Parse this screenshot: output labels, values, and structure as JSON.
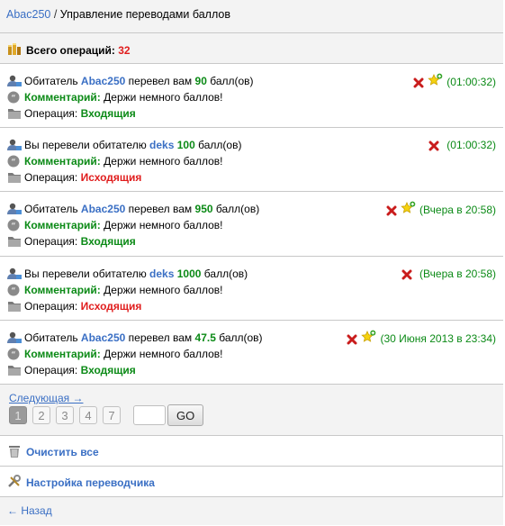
{
  "header": {
    "user_link": "Abac250",
    "separator": " / ",
    "title": "Управление переводами баллов"
  },
  "total": {
    "label": "Всего операций:",
    "count": "32"
  },
  "operations": [
    {
      "prefix": "Обитатель",
      "user": "Abac250",
      "middle": "перевел вам",
      "amount": "90",
      "suffix": "балл(ов)",
      "comment_label": "Комментарий:",
      "comment": "Держи немного баллов!",
      "op_label": "Операция:",
      "op_type": "Входящия",
      "op_dir": "in",
      "time": "(01:00:32)",
      "has_star": true
    },
    {
      "prefix": "Вы перевели обитателю",
      "user": "deks",
      "middle": "",
      "amount": "100",
      "suffix": "балл(ов)",
      "comment_label": "Комментарий:",
      "comment": "Держи немного баллов!",
      "op_label": "Операция:",
      "op_type": "Исходящия",
      "op_dir": "out",
      "time": "(01:00:32)",
      "has_star": false
    },
    {
      "prefix": "Обитатель",
      "user": "Abac250",
      "middle": "перевел вам",
      "amount": "950",
      "suffix": "балл(ов)",
      "comment_label": "Комментарий:",
      "comment": "Держи немного баллов!",
      "op_label": "Операция:",
      "op_type": "Входящия",
      "op_dir": "in",
      "time": "(Вчера в 20:58)",
      "has_star": true
    },
    {
      "prefix": "Вы перевели обитателю",
      "user": "deks",
      "middle": "",
      "amount": "1000",
      "suffix": "балл(ов)",
      "comment_label": "Комментарий:",
      "comment": "Держи немного баллов!",
      "op_label": "Операция:",
      "op_type": "Исходящия",
      "op_dir": "out",
      "time": "(Вчера в 20:58)",
      "has_star": false
    },
    {
      "prefix": "Обитатель",
      "user": "Abac250",
      "middle": "перевел вам",
      "amount": "47.5",
      "suffix": "балл(ов)",
      "comment_label": "Комментарий:",
      "comment": "Держи немного баллов!",
      "op_label": "Операция:",
      "op_type": "Входящия",
      "op_dir": "in",
      "time": "(30 Июня 2013 в 23:34)",
      "has_star": true
    }
  ],
  "pager": {
    "next_label": "Следующая →",
    "pages": [
      "1",
      "2",
      "3",
      "4",
      "7"
    ],
    "active_page": "1",
    "go_label": "GO"
  },
  "menu": {
    "clear_label": "Очистить все",
    "settings_label": "Настройка переводчика"
  },
  "back": {
    "label": "← Назад"
  },
  "colors": {
    "link": "#3a6fc4",
    "green": "#0b8a16",
    "red": "#e01d1d"
  }
}
